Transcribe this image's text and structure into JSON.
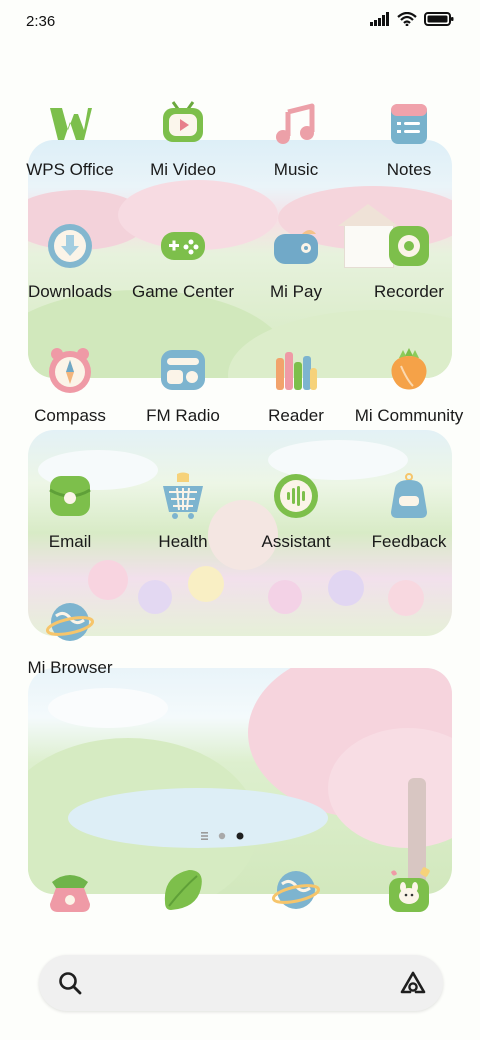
{
  "status_bar": {
    "time": "2:36"
  },
  "apps": [
    {
      "label": "WPS Office",
      "icon": "wps-office-icon"
    },
    {
      "label": "Mi Video",
      "icon": "mi-video-icon"
    },
    {
      "label": "Music",
      "icon": "music-icon"
    },
    {
      "label": "Notes",
      "icon": "notes-icon"
    },
    {
      "label": "Downloads",
      "icon": "downloads-icon"
    },
    {
      "label": "Game Center",
      "icon": "game-center-icon"
    },
    {
      "label": "Mi Pay",
      "icon": "mi-pay-icon"
    },
    {
      "label": "Recorder",
      "icon": "recorder-icon"
    },
    {
      "label": "Compass",
      "icon": "compass-icon"
    },
    {
      "label": "FM Radio",
      "icon": "fm-radio-icon"
    },
    {
      "label": "Reader",
      "icon": "reader-icon"
    },
    {
      "label": "Mi Community",
      "icon": "mi-community-icon"
    },
    {
      "label": "Email",
      "icon": "email-icon"
    },
    {
      "label": "Health",
      "icon": "health-icon"
    },
    {
      "label": "Assistant",
      "icon": "assistant-icon"
    },
    {
      "label": "Feedback",
      "icon": "feedback-icon"
    },
    {
      "label": "Mi Browser",
      "icon": "mi-browser-icon"
    }
  ],
  "dock": [
    {
      "icon": "phone-icon"
    },
    {
      "icon": "messages-icon"
    },
    {
      "icon": "browser-icon"
    },
    {
      "icon": "camera-icon"
    }
  ],
  "page_indicator": {
    "pages": 2,
    "current": 2
  },
  "search_bar": {
    "left_icon": "search-icon",
    "right_icon": "google-lens-icon"
  }
}
